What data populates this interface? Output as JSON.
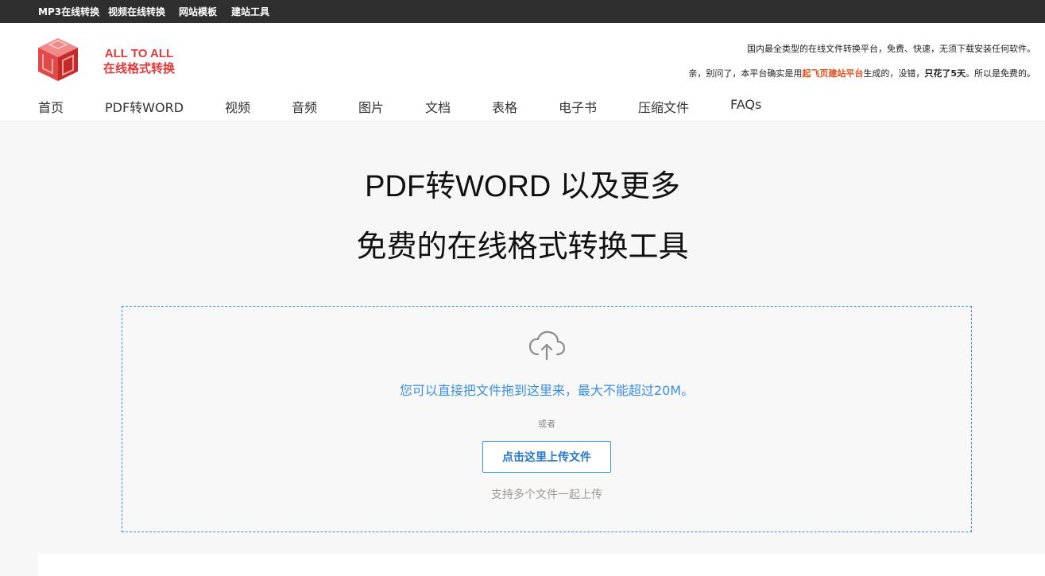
{
  "topbar": {
    "links": [
      "MP3在线转换",
      "视频在线转换",
      "网站模板",
      "建站工具"
    ]
  },
  "logo": {
    "line1": "ALL TO ALL",
    "line2": "在线格式转换",
    "color": "#e23a3a"
  },
  "tagline": {
    "line1": "国内最全类型的在线文件转换平台，免费、快速，无须下载安装任何软件。",
    "line2_prefix": "亲，别问了，本平台确实是用",
    "line2_link": "起飞页建站平台",
    "line2_middle": "生成的，没错，",
    "line2_bold": "只花了5天",
    "line2_suffix": "。所以是免费的。"
  },
  "nav": {
    "items": [
      "首页",
      "PDF转WORD",
      "视频",
      "音频",
      "图片",
      "文档",
      "表格",
      "电子书",
      "压缩文件",
      "FAQs"
    ]
  },
  "hero": {
    "title": "PDF转WORD 以及更多",
    "subtitle": "免费的在线格式转换工具"
  },
  "upload": {
    "icon": "cloud-upload-icon",
    "drop_text": "您可以直接把文件拖到这里来，最大不能超过20M。",
    "or_text": "或者",
    "button_label": "点击这里上传文件",
    "multi_text": "支持多个文件一起上传",
    "accent_color": "#3a8ee0"
  }
}
